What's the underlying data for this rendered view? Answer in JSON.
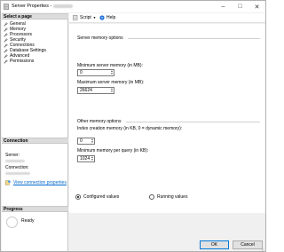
{
  "window": {
    "title": "Server Properties -",
    "minimize_glyph": "–",
    "maximize_glyph": "□",
    "close_glyph": "✕"
  },
  "left_pane": {
    "select_page_header": "Select a page",
    "pages": [
      {
        "label": "General",
        "icon": "wrench-icon"
      },
      {
        "label": "Memory",
        "icon": "wrench-icon"
      },
      {
        "label": "Processors",
        "icon": "wrench-icon"
      },
      {
        "label": "Security",
        "icon": "wrench-icon"
      },
      {
        "label": "Connections",
        "icon": "wrench-icon"
      },
      {
        "label": "Database Settings",
        "icon": "wrench-icon"
      },
      {
        "label": "Advanced",
        "icon": "wrench-icon"
      },
      {
        "label": "Permissions",
        "icon": "wrench-icon"
      }
    ],
    "connection_header": "Connection",
    "server_label": "Server:",
    "connection_label": "Connection:",
    "view_connection_properties": "View connection properties",
    "progress_header": "Progress",
    "progress_status": "Ready"
  },
  "toolbar": {
    "script_label": "Script",
    "help_label": "Help"
  },
  "server_memory_options": {
    "group_title": "Server memory options",
    "min_label": "Minimum server memory (in MB):",
    "min_value": "0",
    "max_label": "Maximum server memory (in MB):",
    "max_value": "26624"
  },
  "other_memory_options": {
    "group_title": "Other memory options",
    "index_label": "Index creation memory (in KB, 0 = dynamic memory):",
    "index_value": "0",
    "query_label": "Minimum memory per query (in KB):",
    "query_value": "1024"
  },
  "value_mode": {
    "configured_label": "Configured values",
    "running_label": "Running values",
    "selected": "configured"
  },
  "buttons": {
    "ok_label": "OK",
    "cancel_label": "Cancel"
  },
  "colors": {
    "link": "#0066cc",
    "ok_border": "#0078d7",
    "pane_header_bg": "#dcdcdc",
    "wrench": "#555555"
  }
}
